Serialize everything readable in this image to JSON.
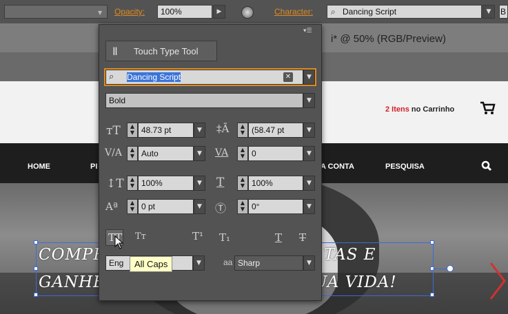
{
  "control_bar": {
    "opacity_label": "Opacity:",
    "opacity_value": "100%",
    "character_label": "Character:",
    "font_value": "Dancing Script",
    "truncated_label": "B"
  },
  "document": {
    "tab_title": "i* @ 50% (RGB/Preview)"
  },
  "website": {
    "cart_text_highlight": "2 Itens",
    "cart_text_rest": "no Carrinho",
    "nav": [
      "HOME",
      "PI",
      "A CONTA",
      "PESQUISA"
    ],
    "hero_line1_left": "COMPR",
    "hero_line1_right": "TAS E",
    "hero_line2": "GANHE MIL VANTAGENS NA SUA VIDA!"
  },
  "panel": {
    "touch_type_label": "Touch Type Tool",
    "font_family": "Dancing Script",
    "font_style": "Bold",
    "font_size": "48.73 pt",
    "leading": "(58.47 pt",
    "kerning": "Auto",
    "tracking": "0",
    "vertical_scale": "100%",
    "horizontal_scale": "100%",
    "baseline_shift": "0 pt",
    "rotation": "0°",
    "language": "Eng",
    "antialias": "Sharp",
    "antialias_icon_text": "aa",
    "tooltip": "All Caps"
  }
}
